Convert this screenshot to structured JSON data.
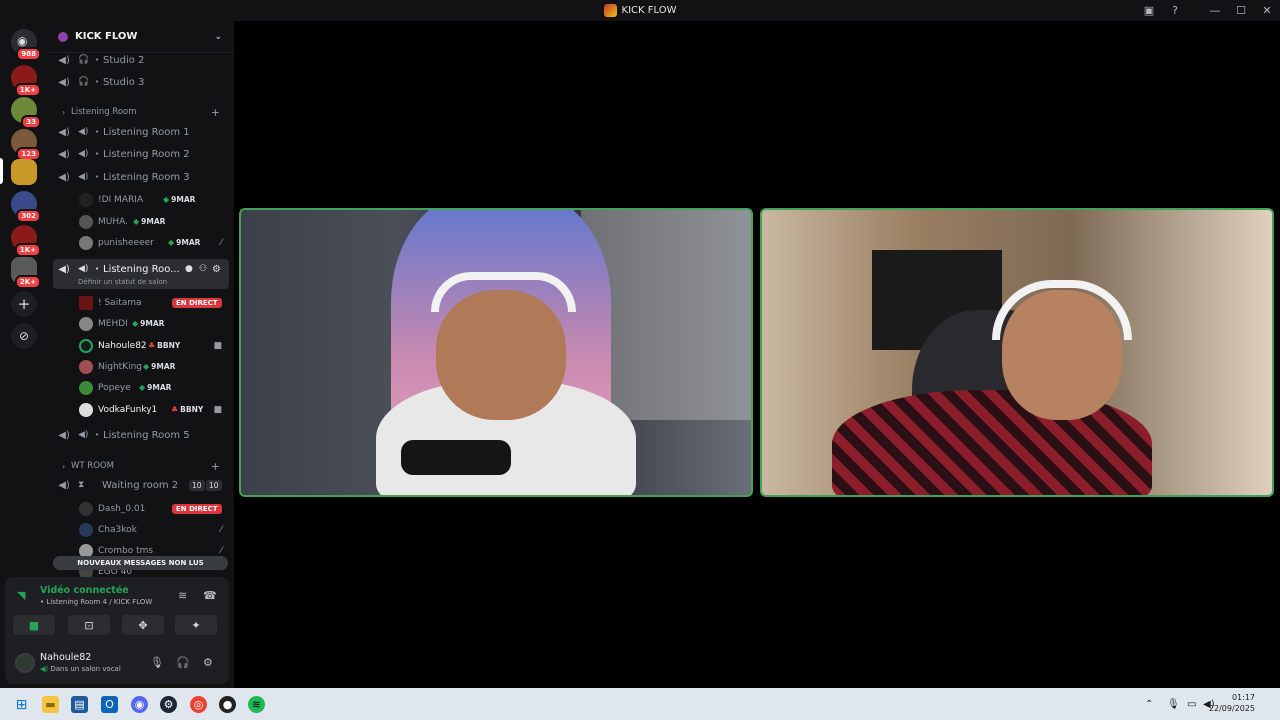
{
  "window": {
    "title": "KICK FLOW"
  },
  "servers": [
    {
      "badge": "988",
      "color": "#4a4d55"
    },
    {
      "badge": "1K+",
      "color": "#8b1a1a"
    },
    {
      "badge": "33",
      "color": "#6a8a3a"
    },
    {
      "badge": "123",
      "color": "#7a5a3a"
    },
    {
      "badge": "",
      "color": "#c99a2a"
    },
    {
      "badge": "302",
      "color": "#3a4a8a"
    },
    {
      "badge": "1K+",
      "color": "#8b1a1a"
    },
    {
      "badge": "2K+",
      "color": "#5a5a5a"
    }
  ],
  "guild": {
    "name": "KICK FLOW"
  },
  "channels": {
    "studio2": "Studio 2",
    "studio3": "Studio 3",
    "cat_listening": "Listening Room",
    "lr1": "Listening Room 1",
    "lr2": "Listening Room 2",
    "lr3": "Listening Room 3",
    "lr4": "Listening Roo...",
    "lr4_hint": "Définir un statut de salon",
    "lr5": "Listening Room 5",
    "cat_wt": "WT ROOM",
    "waiting": "Waiting room 2",
    "waiting_count_a": "10",
    "waiting_count_b": "10"
  },
  "lr3_users": [
    {
      "name": "!DI MARIA",
      "tag": "9MAR"
    },
    {
      "name": "MUHA.",
      "tag": "9MAR"
    },
    {
      "name": "punisheeeer",
      "tag": "9MAR"
    }
  ],
  "lr4_users": [
    {
      "name": "! Saitama",
      "live": "EN DIRECT"
    },
    {
      "name": "MEHDI",
      "tag": "9MAR"
    },
    {
      "name": "Nahoule82",
      "tag": "BBNY"
    },
    {
      "name": "NightKing",
      "tag": "9MAR"
    },
    {
      "name": "Popeye",
      "tag": "9MAR"
    },
    {
      "name": "VodkaFunky1",
      "tag": "BBNY"
    }
  ],
  "wt_users": [
    {
      "name": "Dash_0.01",
      "live": "EN DIRECT"
    },
    {
      "name": "Cha3kok"
    },
    {
      "name": "Crombo tms"
    },
    {
      "name": "EGO 40"
    }
  ],
  "toast": "NOUVEAUX MESSAGES NON LUS",
  "voice": {
    "status": "Vidéo connectée",
    "location": "Listening Room 4 / KICK FLOW"
  },
  "me": {
    "name": "Nahoule82",
    "status": "Dans un salon vocal"
  },
  "clock": {
    "time": "01:17",
    "date": "22/09/2025"
  },
  "colors": {
    "accent_green": "#23a559",
    "live_red": "#da373c",
    "tile_border": "#43a25a"
  }
}
